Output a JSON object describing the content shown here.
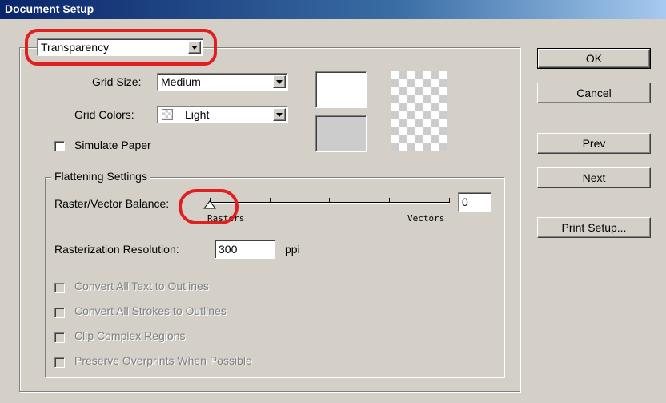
{
  "window": {
    "title": "Document Setup"
  },
  "section_select": {
    "value": "Transparency"
  },
  "grid_size": {
    "label": "Grid Size:",
    "value": "Medium"
  },
  "grid_colors": {
    "label": "Grid Colors:",
    "value": "Light"
  },
  "simulate_paper": {
    "label": "Simulate Paper",
    "checked": false
  },
  "flattening": {
    "title": "Flattening Settings",
    "balance_label": "Raster/Vector Balance:",
    "balance_value": "0",
    "rasters_label": "Rasters",
    "vectors_label": "Vectors",
    "resolution_label": "Rasterization Resolution:",
    "resolution_value": "300",
    "resolution_unit": "ppi",
    "options": [
      {
        "label": "Convert All Text to Outlines",
        "enabled": false
      },
      {
        "label": "Convert All Strokes to Outlines",
        "enabled": false
      },
      {
        "label": "Clip Complex Regions",
        "enabled": false
      },
      {
        "label": "Preserve Overprints When Possible",
        "enabled": false
      }
    ]
  },
  "buttons": {
    "ok": "OK",
    "cancel": "Cancel",
    "prev": "Prev",
    "next": "Next",
    "print_setup": "Print Setup..."
  },
  "colors": {
    "dialog_bg": "#d4d0c8",
    "titlebar_start": "#0a246a",
    "highlight_annotation": "#e02020",
    "swatch_gray": "#cccccc"
  }
}
